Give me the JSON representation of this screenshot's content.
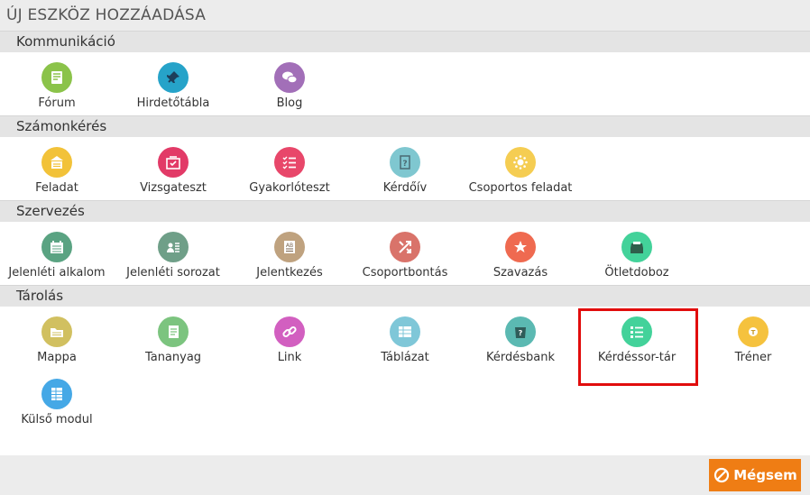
{
  "header": {
    "title": "ÚJ ESZKÖZ HOZZÁADÁSA"
  },
  "sections": [
    {
      "title": "Kommunikáció",
      "items": [
        {
          "label": "Fórum",
          "icon": "forum-icon",
          "color": "#8bc34a"
        },
        {
          "label": "Hirdetőtábla",
          "icon": "pin-icon",
          "color": "#26a3c9"
        },
        {
          "label": "Blog",
          "icon": "chat-bubbles-icon",
          "color": "#a26fb8"
        }
      ]
    },
    {
      "title": "Számonkérés",
      "items": [
        {
          "label": "Feladat",
          "icon": "assignment-icon",
          "color": "#f2c239"
        },
        {
          "label": "Vizsgateszt",
          "icon": "exam-icon",
          "color": "#e23a67"
        },
        {
          "label": "Gyakorlóteszt",
          "icon": "checklist-icon",
          "color": "#e8476a"
        },
        {
          "label": "Kérdőív",
          "icon": "questionnaire-icon",
          "color": "#7fc7d0"
        },
        {
          "label": "Csoportos feladat",
          "icon": "group-task-icon",
          "color": "#f5cd52"
        }
      ]
    },
    {
      "title": "Szervezés",
      "items": [
        {
          "label": "Jelenléti alkalom",
          "icon": "calendar-icon",
          "color": "#5aa382"
        },
        {
          "label": "Jelenléti sorozat",
          "icon": "attendance-list-icon",
          "color": "#6f9f88"
        },
        {
          "label": "Jelentkezés",
          "icon": "registration-icon",
          "color": "#bfa27f"
        },
        {
          "label": "Csoportbontás",
          "icon": "split-icon",
          "color": "#d9736a"
        },
        {
          "label": "Szavazás",
          "icon": "vote-star-icon",
          "color": "#ef6a50"
        },
        {
          "label": "Ötletdoboz",
          "icon": "idea-box-icon",
          "color": "#43d29a"
        }
      ]
    },
    {
      "title": "Tárolás",
      "items": [
        {
          "label": "Mappa",
          "icon": "folder-icon",
          "color": "#d1c060"
        },
        {
          "label": "Tananyag",
          "icon": "learning-material-icon",
          "color": "#7cc47f"
        },
        {
          "label": "Link",
          "icon": "link-icon",
          "color": "#d25fc0"
        },
        {
          "label": "Táblázat",
          "icon": "table-icon",
          "color": "#7fc7d8"
        },
        {
          "label": "Kérdésbank",
          "icon": "question-bank-icon",
          "color": "#5bb9b2"
        },
        {
          "label": "Kérdéssor-tár",
          "icon": "question-list-icon",
          "color": "#43d29a"
        },
        {
          "label": "Tréner",
          "icon": "trainer-icon",
          "color": "#f5c23e"
        },
        {
          "label": "Külső modul",
          "icon": "external-module-icon",
          "color": "#45a8e6"
        }
      ]
    }
  ],
  "footer": {
    "cancel_label": "Mégsem",
    "cancel_color": "#ef7d14"
  }
}
